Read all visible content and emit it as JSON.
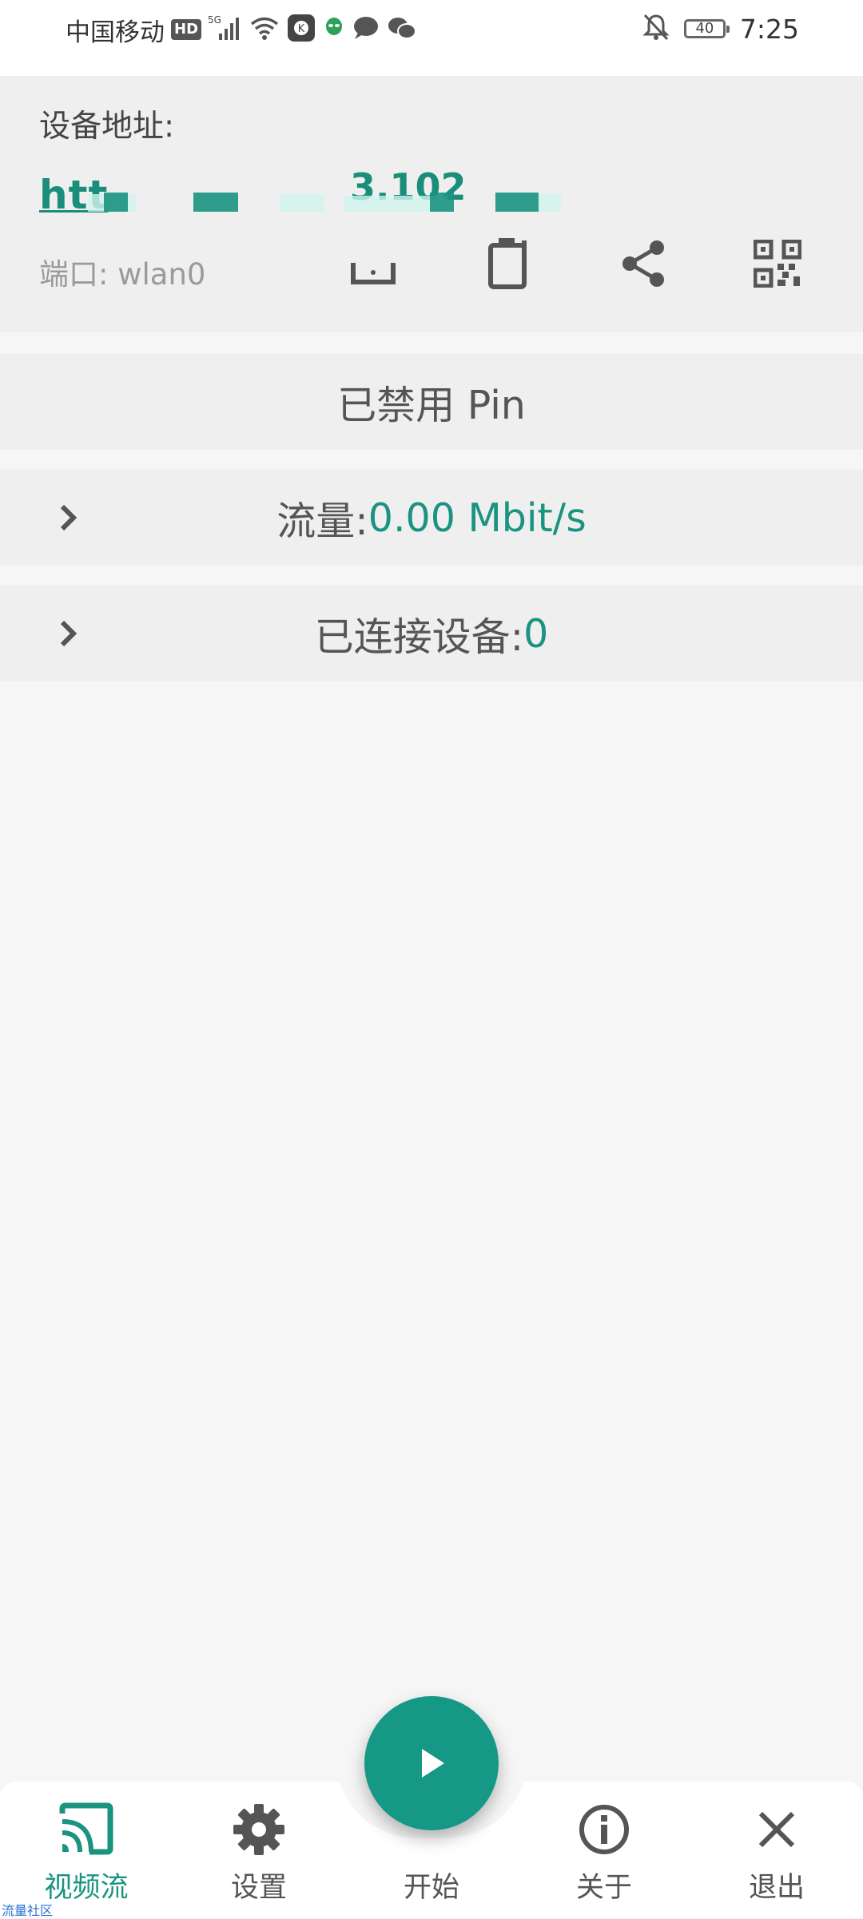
{
  "status_bar": {
    "carrier": "中国移动",
    "hd": "HD",
    "network": "5G",
    "battery": "40",
    "time": "7:25"
  },
  "address": {
    "label": "设备地址:",
    "url_visible_prefix": "htt",
    "url_visible_fragment": "3.102",
    "port_label": "端口: wlan0"
  },
  "pin_status": "已禁用 Pin",
  "traffic": {
    "label": "流量: ",
    "value": "0.00 Mbit/s"
  },
  "clients": {
    "label": "已连接设备: ",
    "value": "0"
  },
  "bottom_nav": {
    "items": [
      {
        "label": "视频流",
        "icon": "cast-icon"
      },
      {
        "label": "设置",
        "icon": "gear-icon"
      },
      {
        "label": "开始",
        "icon": "play-icon"
      },
      {
        "label": "关于",
        "icon": "info-icon"
      },
      {
        "label": "退出",
        "icon": "close-icon"
      }
    ]
  },
  "watermark": "流量社区",
  "colors": {
    "accent": "#1a9380",
    "fab": "#169886",
    "card_bg": "#efefef",
    "page_bg": "#f6f6f6"
  }
}
